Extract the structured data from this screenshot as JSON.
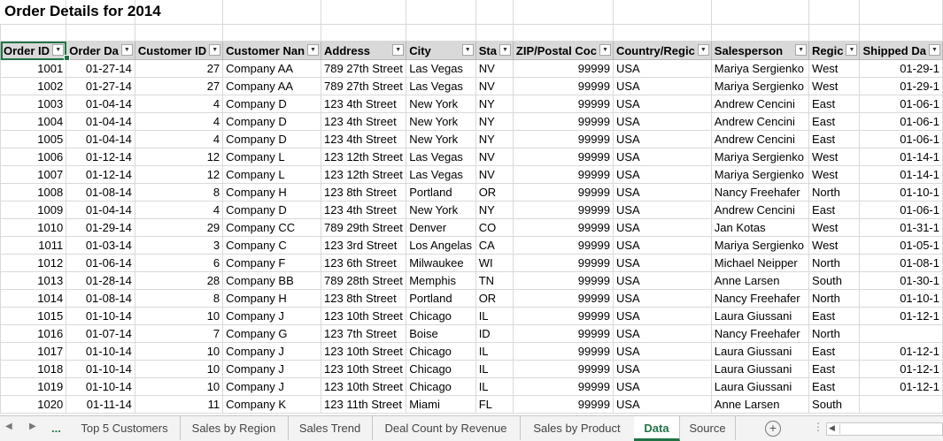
{
  "title": "Order Details for 2014",
  "columns": [
    "Order ID",
    "Order Da",
    "Customer ID",
    "Customer Nan",
    "Address",
    "City",
    "Sta",
    "ZIP/Postal Coc",
    "Country/Regic",
    "Salesperson",
    "Regic",
    "Shipped Da"
  ],
  "rows": [
    [
      "1001",
      "01-27-14",
      "27",
      "Company AA",
      "789 27th Street",
      "Las Vegas",
      "NV",
      "99999",
      "USA",
      "Mariya Sergienko",
      "West",
      "01-29-1"
    ],
    [
      "1002",
      "01-27-14",
      "27",
      "Company AA",
      "789 27th Street",
      "Las Vegas",
      "NV",
      "99999",
      "USA",
      "Mariya Sergienko",
      "West",
      "01-29-1"
    ],
    [
      "1003",
      "01-04-14",
      "4",
      "Company D",
      "123 4th Street",
      "New York",
      "NY",
      "99999",
      "USA",
      "Andrew Cencini",
      "East",
      "01-06-1"
    ],
    [
      "1004",
      "01-04-14",
      "4",
      "Company D",
      "123 4th Street",
      "New York",
      "NY",
      "99999",
      "USA",
      "Andrew Cencini",
      "East",
      "01-06-1"
    ],
    [
      "1005",
      "01-04-14",
      "4",
      "Company D",
      "123 4th Street",
      "New York",
      "NY",
      "99999",
      "USA",
      "Andrew Cencini",
      "East",
      "01-06-1"
    ],
    [
      "1006",
      "01-12-14",
      "12",
      "Company L",
      "123 12th Street",
      "Las Vegas",
      "NV",
      "99999",
      "USA",
      "Mariya Sergienko",
      "West",
      "01-14-1"
    ],
    [
      "1007",
      "01-12-14",
      "12",
      "Company L",
      "123 12th Street",
      "Las Vegas",
      "NV",
      "99999",
      "USA",
      "Mariya Sergienko",
      "West",
      "01-14-1"
    ],
    [
      "1008",
      "01-08-14",
      "8",
      "Company H",
      "123 8th Street",
      "Portland",
      "OR",
      "99999",
      "USA",
      "Nancy Freehafer",
      "North",
      "01-10-1"
    ],
    [
      "1009",
      "01-04-14",
      "4",
      "Company D",
      "123 4th Street",
      "New York",
      "NY",
      "99999",
      "USA",
      "Andrew Cencini",
      "East",
      "01-06-1"
    ],
    [
      "1010",
      "01-29-14",
      "29",
      "Company CC",
      "789 29th Street",
      "Denver",
      "CO",
      "99999",
      "USA",
      "Jan Kotas",
      "West",
      "01-31-1"
    ],
    [
      "1011",
      "01-03-14",
      "3",
      "Company C",
      "123 3rd Street",
      "Los Angelas",
      "CA",
      "99999",
      "USA",
      "Mariya Sergienko",
      "West",
      "01-05-1"
    ],
    [
      "1012",
      "01-06-14",
      "6",
      "Company F",
      "123 6th Street",
      "Milwaukee",
      "WI",
      "99999",
      "USA",
      "Michael Neipper",
      "North",
      "01-08-1"
    ],
    [
      "1013",
      "01-28-14",
      "28",
      "Company BB",
      "789 28th Street",
      "Memphis",
      "TN",
      "99999",
      "USA",
      "Anne Larsen",
      "South",
      "01-30-1"
    ],
    [
      "1014",
      "01-08-14",
      "8",
      "Company H",
      "123 8th Street",
      "Portland",
      "OR",
      "99999",
      "USA",
      "Nancy Freehafer",
      "North",
      "01-10-1"
    ],
    [
      "1015",
      "01-10-14",
      "10",
      "Company J",
      "123 10th Street",
      "Chicago",
      "IL",
      "99999",
      "USA",
      "Laura Giussani",
      "East",
      "01-12-1"
    ],
    [
      "1016",
      "01-07-14",
      "7",
      "Company G",
      "123 7th Street",
      "Boise",
      "ID",
      "99999",
      "USA",
      "Nancy Freehafer",
      "North",
      ""
    ],
    [
      "1017",
      "01-10-14",
      "10",
      "Company J",
      "123 10th Street",
      "Chicago",
      "IL",
      "99999",
      "USA",
      "Laura Giussani",
      "East",
      "01-12-1"
    ],
    [
      "1018",
      "01-10-14",
      "10",
      "Company J",
      "123 10th Street",
      "Chicago",
      "IL",
      "99999",
      "USA",
      "Laura Giussani",
      "East",
      "01-12-1"
    ],
    [
      "1019",
      "01-10-14",
      "10",
      "Company J",
      "123 10th Street",
      "Chicago",
      "IL",
      "99999",
      "USA",
      "Laura Giussani",
      "East",
      "01-12-1"
    ],
    [
      "1020",
      "01-11-14",
      "11",
      "Company K",
      "123 11th Street",
      "Miami",
      "FL",
      "99999",
      "USA",
      "Anne Larsen",
      "South",
      ""
    ]
  ],
  "tabs": {
    "ellipsis": "...",
    "items": [
      "Top 5 Customers",
      "Sales by Region",
      "Sales Trend",
      "Deal Count by Revenue",
      "Sales by Product",
      "Data",
      "Source"
    ],
    "active": "Data"
  },
  "colors": {
    "accent": "#217346",
    "header_bg": "#d9d9d9",
    "gridline": "#d9d9d9"
  }
}
